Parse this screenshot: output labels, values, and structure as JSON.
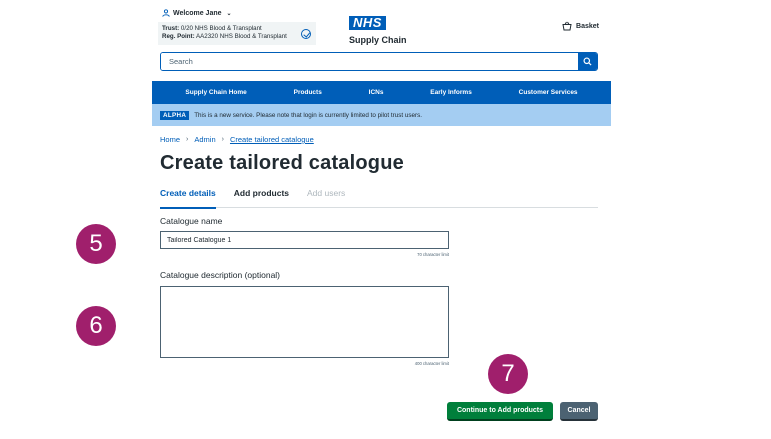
{
  "header": {
    "welcome": "Welcome Jane",
    "trust_label": "Trust:",
    "trust_value": "0/20 NHS Blood & Transplant",
    "reg_label": "Reg. Point:",
    "reg_value": "AA2320 NHS Blood & Transplant",
    "logo_nhs": "NHS",
    "logo_subtitle": "Supply Chain",
    "basket": "Basket"
  },
  "search": {
    "placeholder": "Search"
  },
  "nav": {
    "items": [
      "Supply Chain Home",
      "Products",
      "ICNs",
      "Early Informs",
      "Customer Services"
    ]
  },
  "banner": {
    "tag": "ALPHA",
    "text": "This is a new service. Please note that login is currently limited to pilot trust users."
  },
  "breadcrumb": {
    "home": "Home",
    "admin": "Admin",
    "current": "Create tailored catalogue"
  },
  "page_title": "Create tailored catalogue",
  "tabs": [
    "Create details",
    "Add products",
    "Add users"
  ],
  "form": {
    "name_label": "Catalogue name",
    "name_value": "Tailored Catalogue 1",
    "name_limit": "70 character limit",
    "desc_label": "Catalogue description (optional)",
    "desc_value": "",
    "desc_limit": "400 character limit"
  },
  "actions": {
    "continue": "Continue to Add products",
    "cancel": "Cancel"
  },
  "steps": [
    "5",
    "6",
    "7"
  ],
  "colors": {
    "nhs_blue": "#005eb8",
    "green": "#007f3b",
    "step": "#a01f6c",
    "banner": "#a4cdf2"
  }
}
